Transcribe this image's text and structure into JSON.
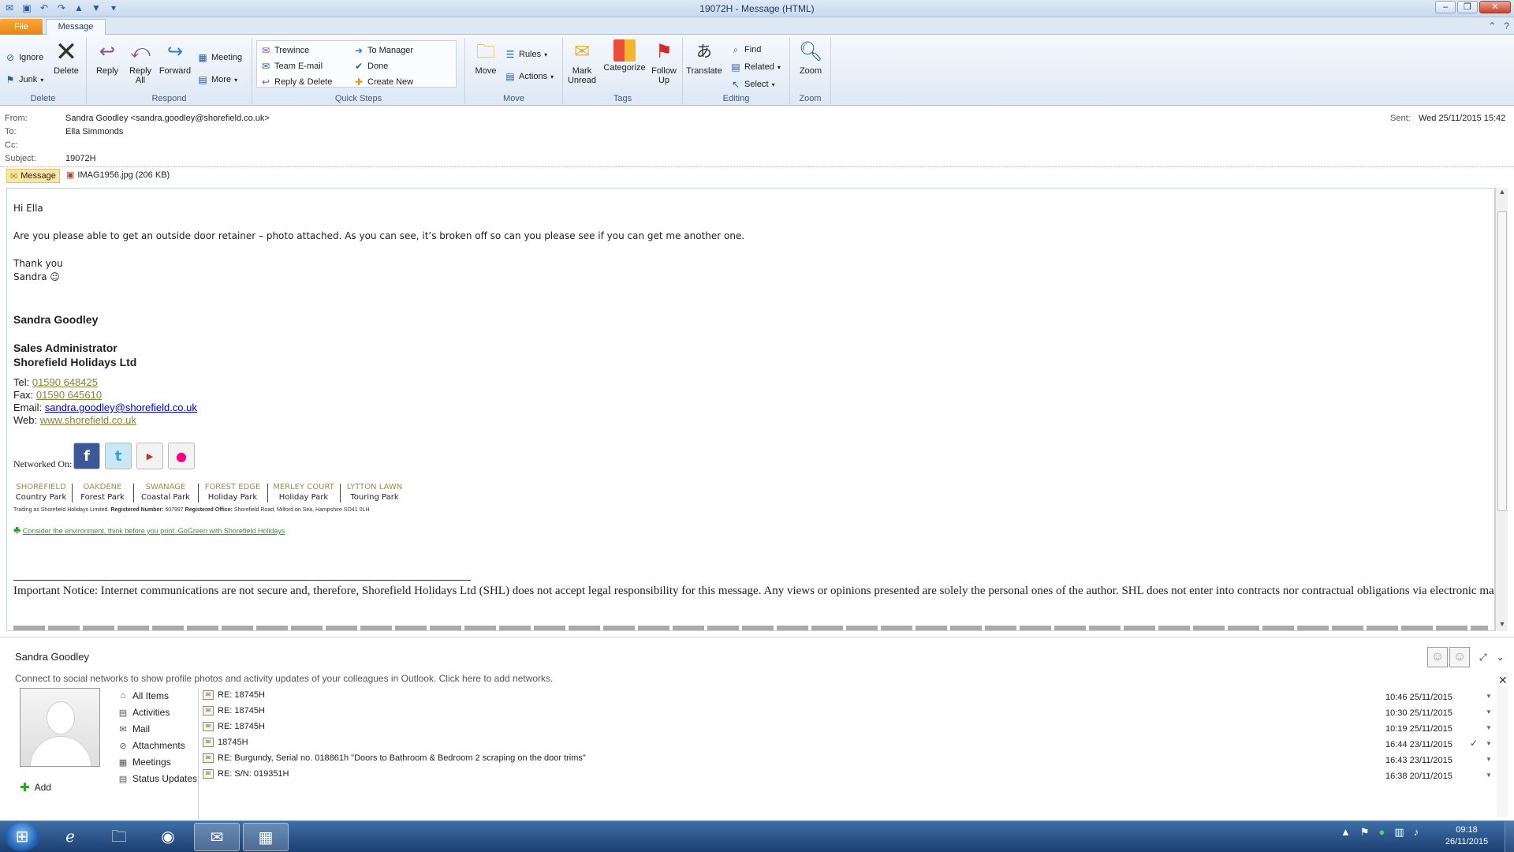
{
  "window": {
    "title": "19072H - Message (HTML)"
  },
  "tabs": {
    "file": "File",
    "message": "Message"
  },
  "ribbon": {
    "delete_group": {
      "label": "Delete",
      "ignore": "Ignore",
      "junk": "Junk",
      "delete": "Delete"
    },
    "respond_group": {
      "label": "Respond",
      "reply": "Reply",
      "reply_all_1": "Reply",
      "reply_all_2": "All",
      "forward": "Forward",
      "meeting": "Meeting",
      "more": "More"
    },
    "quicksteps_group": {
      "label": "Quick Steps",
      "trewince": "Trewince",
      "team_email": "Team E-mail",
      "reply_delete": "Reply & Delete",
      "to_manager": "To Manager",
      "done": "Done",
      "create_new": "Create New"
    },
    "move_group": {
      "label": "Move",
      "move": "Move",
      "rules": "Rules",
      "actions": "Actions"
    },
    "tags_group": {
      "label": "Tags",
      "mark_unread_1": "Mark",
      "mark_unread_2": "Unread",
      "categorize": "Categorize",
      "follow_up_1": "Follow",
      "follow_up_2": "Up"
    },
    "editing_group": {
      "label": "Editing",
      "translate": "Translate",
      "find": "Find",
      "related": "Related",
      "select": "Select"
    },
    "zoom_group": {
      "label": "Zoom",
      "zoom": "Zoom"
    }
  },
  "header": {
    "from_label": "From:",
    "from_value": "Sandra Goodley <sandra.goodley@shorefield.co.uk>",
    "to_label": "To:",
    "to_value": "Ella Simmonds",
    "cc_label": "Cc:",
    "subject_label": "Subject:",
    "subject_value": "19072H",
    "sent_label": "Sent:",
    "sent_value": "Wed 25/11/2015 15:42"
  },
  "attachments": {
    "message_tab": "Message",
    "file": "IMAG1956.jpg (206 KB)"
  },
  "body": {
    "greeting": "Hi Ella",
    "line1": "Are you please able to get an outside door retainer – photo attached.  As you can see, it’s broken off so can you please see if you can get me another one.",
    "thanks": "Thank you",
    "signoff": "Sandra ☺",
    "sig_name": "Sandra Goodley",
    "sig_title": "Sales Administrator",
    "sig_company": "Shorefield Holidays Ltd",
    "tel_label": "Tel: ",
    "tel_value": "01590 648425",
    "fax_label": "Fax: ",
    "fax_value": "01590 645610",
    "email_label": "Email: ",
    "email_value": "sandra.goodley@shorefield.co.uk",
    "web_label": "Web: ",
    "web_value": "www.shorefield.co.uk",
    "networked_on": "Networked On:",
    "parks": [
      {
        "a": "SHOREFIELD",
        "b": "Country Park"
      },
      {
        "a": "OAKDENE",
        "b": "Forest Park"
      },
      {
        "a": "SWANAGE",
        "b": "Coastal Park"
      },
      {
        "a": "FOREST EDGE",
        "b": "Holiday Park"
      },
      {
        "a": "MERLEY COURT",
        "b": "Holiday Park"
      },
      {
        "a": "LYTTON LAWN",
        "b": "Touring Park"
      }
    ],
    "trading_1": "Trading as Shorefield Holidays Limited.",
    "trading_reg_label": "Registered Number:",
    "trading_reg_value": "607997",
    "trading_office_label": "Registered Office:",
    "trading_office_value": "Shorefield Road, Milford on Sea, Hampshire SO41 0LH",
    "gogreen": "Consider the environment, think before you print. GoGreen with Shorefield Holidays",
    "notice": "Important Notice: Internet communications are not secure and, therefore, Shorefield Holidays Ltd (SHL) does not accept legal responsibility for this message. Any views or opinions presented are solely the personal ones of the author. SHL does not enter into contracts nor contractual obligations via electronic mail, unless otherwise agreed, in writing, by a Company Director."
  },
  "people_pane": {
    "name": "Sandra Goodley",
    "connect": "Connect to social networks to show profile photos and activity updates of your colleagues in Outlook. Click here to add networks.",
    "add": "Add",
    "nav": [
      "All Items",
      "Activities",
      "Mail",
      "Attachments",
      "Meetings",
      "Status Updates"
    ],
    "items": [
      {
        "subject": "RE: 18745H",
        "time": "10:46  25/11/2015",
        "check": ""
      },
      {
        "subject": "RE: 18745H",
        "time": "10:30  25/11/2015",
        "check": ""
      },
      {
        "subject": "RE: 18745H",
        "time": "10:19  25/11/2015",
        "check": ""
      },
      {
        "subject": "18745H",
        "time": "16:44  23/11/2015",
        "check": "✓"
      },
      {
        "subject": "RE: Burgundy, Serial no. 018861h \"Doors to Bathroom & Bedroom 2 scraping on the door trims\"",
        "time": "16:43  23/11/2015",
        "check": ""
      },
      {
        "subject": "RE: S/N: 019351H",
        "time": "16:38  20/11/2015",
        "check": ""
      }
    ]
  },
  "taskbar": {
    "time": "09:18",
    "date": "26/11/2015"
  }
}
